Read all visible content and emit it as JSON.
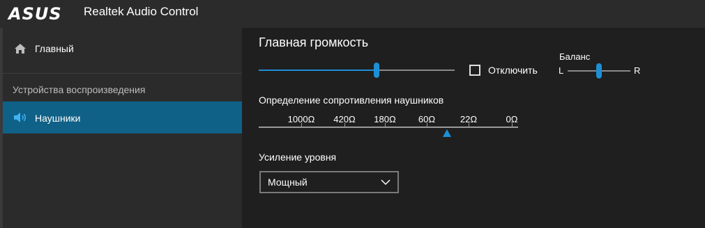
{
  "titlebar": {
    "brand_logo": "ASUS",
    "app_title": "Realtek Audio Control"
  },
  "sidebar": {
    "home_label": "Главный",
    "home_icon": "home-icon",
    "section_title": "Устройства воспроизведения",
    "device_label": "Наушники",
    "device_icon": "speaker-icon"
  },
  "main": {
    "title": "Главная громкость",
    "volume_level": 0.6,
    "mute_label": "Отключить",
    "mute_checked": false,
    "balance": {
      "title": "Баланс",
      "left_label": "L",
      "right_label": "R",
      "value": 0.5
    },
    "impedance": {
      "title": "Определение сопротивления наушников",
      "labels": [
        "1000Ω",
        "420Ω",
        "180Ω",
        "60Ω",
        "22Ω",
        "0Ω"
      ],
      "selected_position": "between 60Ω and 22Ω"
    },
    "gain": {
      "title": "Усиление уровня",
      "selected": "Мощный"
    }
  },
  "colors": {
    "accent": "#1d8fd5",
    "selected_nav": "#0f6187",
    "background": "#1f1f1f",
    "sidebar": "#2b2b2b"
  }
}
